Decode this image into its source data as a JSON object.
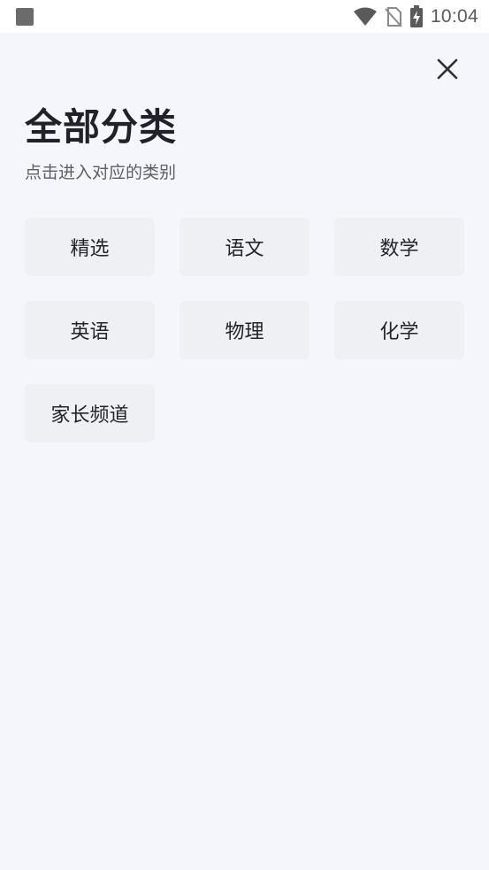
{
  "status_bar": {
    "time": "10:04",
    "icons": [
      "notification-square-icon",
      "wifi-icon",
      "no-sim-icon",
      "battery-charging-icon"
    ]
  },
  "header": {
    "close_icon": "close-icon",
    "title": "全部分类",
    "subtitle": "点击进入对应的类别"
  },
  "categories": [
    {
      "label": "精选"
    },
    {
      "label": "语文"
    },
    {
      "label": "数学"
    },
    {
      "label": "英语"
    },
    {
      "label": "物理"
    },
    {
      "label": "化学"
    },
    {
      "label": "家长频道"
    }
  ],
  "colors": {
    "background": "#f5f6fb",
    "button_bg": "#eef0f4",
    "title_text": "#1f2228",
    "subtitle_text": "#5b5f68"
  }
}
